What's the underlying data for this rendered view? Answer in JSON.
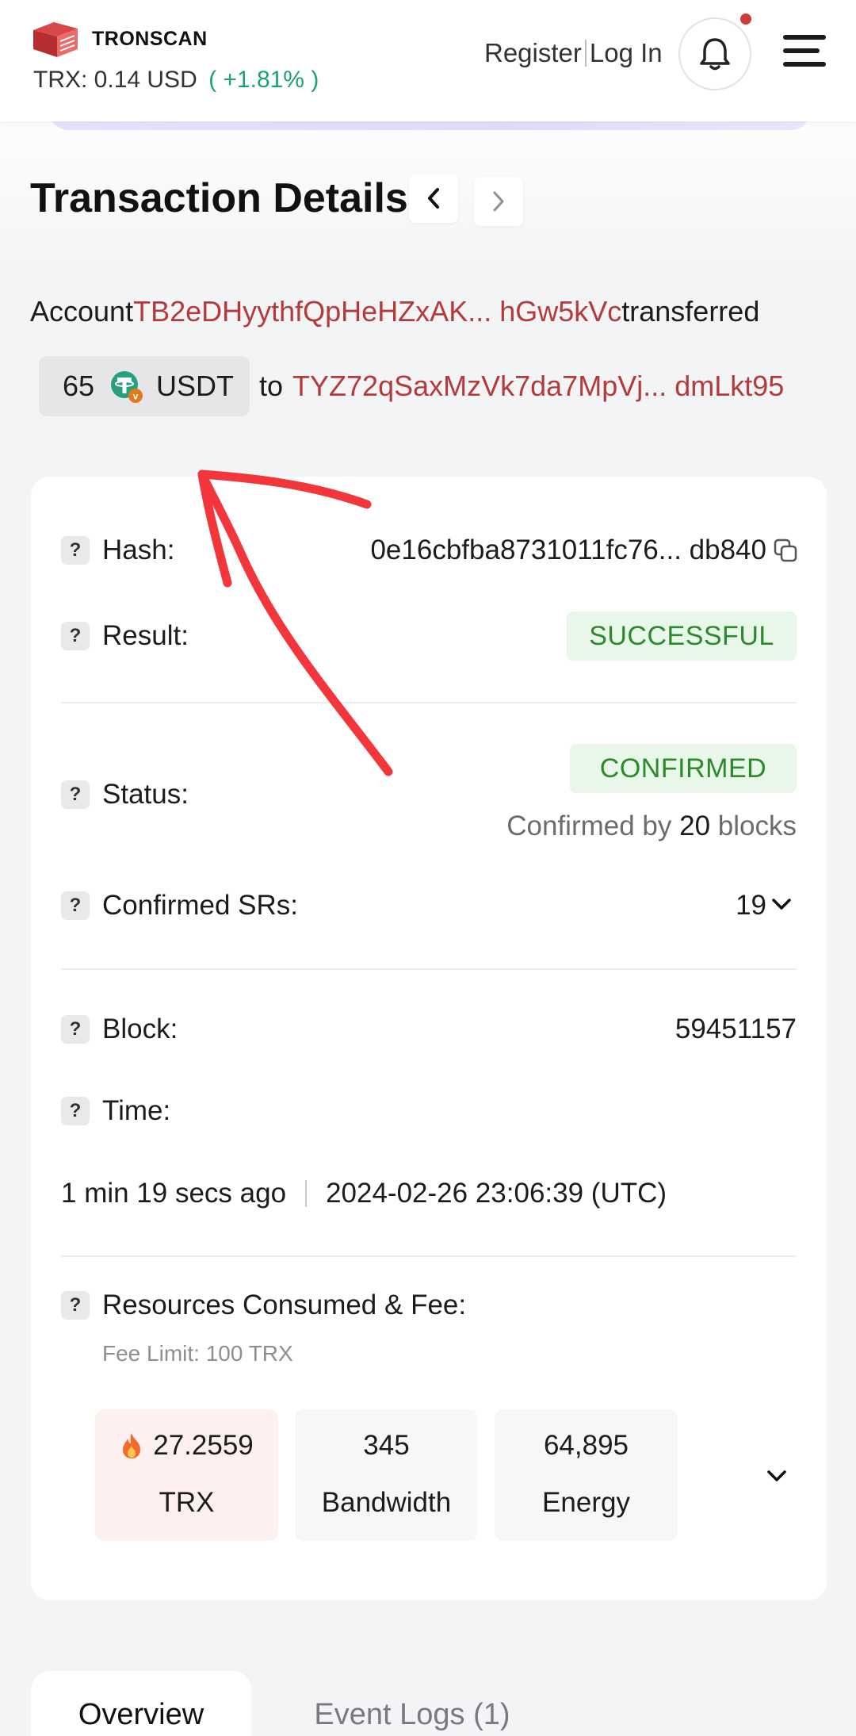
{
  "header": {
    "brand": "TRONSCAN",
    "price_label": "TRX: 0.14 USD",
    "price_change": "( +1.81% )",
    "register": "Register",
    "login": "Log In"
  },
  "page": {
    "title": "Transaction Details"
  },
  "summary": {
    "account_word": "Account",
    "from_address": "TB2eDHyythfQpHeHZxAK... hGw5kVc",
    "transferred_word": "transferred",
    "amount": "65",
    "token": "USDT",
    "to_word": "to",
    "to_address": "TYZ72qSaxMzVk7da7MpVj... dmLkt95"
  },
  "details": {
    "hash_label": "Hash:",
    "hash_value": "0e16cbfba8731011fc76... db840",
    "result_label": "Result:",
    "result_value": "SUCCESSFUL",
    "status_label": "Status:",
    "status_value": "CONFIRMED",
    "confirmed_by_prefix": "Confirmed by",
    "confirmed_by_count": "20",
    "confirmed_by_suffix": "blocks",
    "srs_label": "Confirmed SRs:",
    "srs_value": "19",
    "block_label": "Block:",
    "block_value": "59451157",
    "time_label": "Time:",
    "time_ago": "1 min 19 secs ago",
    "time_utc": "2024-02-26 23:06:39 (UTC)",
    "resources_label": "Resources Consumed & Fee:",
    "fee_limit": "Fee Limit: 100 TRX",
    "resources": [
      {
        "value": "27.2559",
        "unit": "TRX"
      },
      {
        "value": "345",
        "unit": "Bandwidth"
      },
      {
        "value": "64,895",
        "unit": "Energy"
      }
    ]
  },
  "tabs": [
    {
      "label": "Overview",
      "active": true
    },
    {
      "label": "Event Logs (1)",
      "active": false
    }
  ],
  "colors": {
    "address": "#b53a3a",
    "success_text": "#2b8a2b",
    "success_bg": "#e8f7e9",
    "price_up": "#1ba27a",
    "annotation": "#f2363c"
  }
}
